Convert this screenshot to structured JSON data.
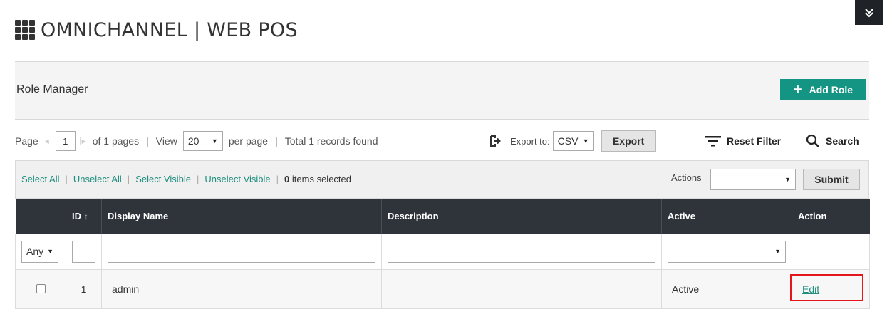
{
  "app": {
    "title": "OMNICHANNEL | WEB POS"
  },
  "header": {
    "heading": "Role Manager",
    "add_button": "Add Role"
  },
  "pager": {
    "page_label": "Page",
    "current_page": "1",
    "of_pages": "of 1 pages",
    "view_label": "View",
    "per_page_value": "20",
    "per_page_label": "per page",
    "total": "Total 1 records found"
  },
  "export": {
    "label": "Export to:",
    "format": "CSV",
    "button": "Export"
  },
  "tools": {
    "reset_filter": "Reset Filter",
    "search": "Search"
  },
  "massaction": {
    "select_all": "Select All",
    "unselect_all": "Unselect All",
    "select_visible": "Select Visible",
    "unselect_visible": "Unselect Visible",
    "selected_count": "0",
    "selected_suffix": "items selected",
    "actions_label": "Actions",
    "actions_value": "",
    "submit": "Submit"
  },
  "table": {
    "columns": [
      "",
      "ID",
      "Display Name",
      "Description",
      "Active",
      "Action"
    ],
    "filter_any": "Any",
    "rows": [
      {
        "id": "1",
        "display_name": "admin",
        "description": "",
        "active": "Active",
        "action": "Edit"
      }
    ]
  },
  "colors": {
    "accent": "#149482",
    "header_dark": "#2f333a",
    "highlight": "#e4161b"
  }
}
